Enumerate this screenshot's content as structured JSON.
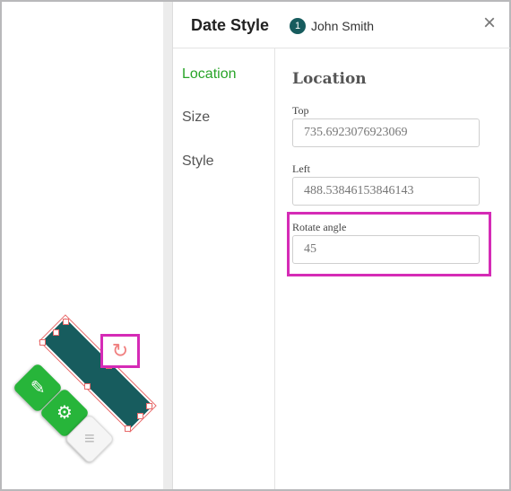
{
  "panel": {
    "title": "Date Style",
    "user_badge": "1",
    "user_name": "John Smith",
    "close_glyph": "×"
  },
  "nav": {
    "items": [
      {
        "label": "Location",
        "active": true
      },
      {
        "label": "Size",
        "active": false
      },
      {
        "label": "Style",
        "active": false
      }
    ]
  },
  "location": {
    "section_title": "Location",
    "top_label": "Top",
    "top_value": "735.6923076923069",
    "left_label": "Left",
    "left_value": "488.53846153846143",
    "rotate_label": "Rotate angle",
    "rotate_value": "45"
  },
  "canvas": {
    "rotate_glyph": "↻",
    "rotation_degrees": 45,
    "actions": [
      {
        "name": "signature",
        "glyph": "✎"
      },
      {
        "name": "settings",
        "glyph": "⚙"
      },
      {
        "name": "delete",
        "glyph": "≡"
      }
    ]
  },
  "colors": {
    "accent_green": "#28a428",
    "field_teal": "#175c5e",
    "highlight_magenta": "#d52bb6"
  }
}
